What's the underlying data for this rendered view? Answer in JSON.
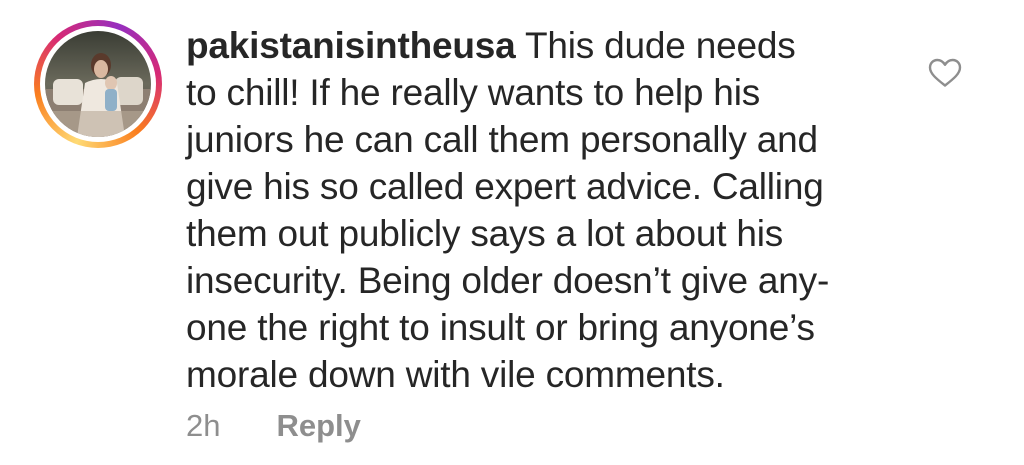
{
  "comment": {
    "username": "pakistanisintheusa",
    "lines": [
      "This dude needs",
      "to chill! If he really wants to help his",
      "juniors he can call them personally and",
      "give his so called expert advice. Calling",
      "them out publicly says a lot about his",
      "insecurity. Being older doesn’t give any-",
      "one the right to insult or bring anyone’s",
      "morale down with vile comments."
    ],
    "timestamp": "2h",
    "reply_label": "Reply",
    "icons": {
      "like": "heart-outline-icon",
      "avatar_ring": "story-ring"
    },
    "colors": {
      "text": "#262626",
      "meta": "#8e8e8e",
      "ring_start": "#feda75",
      "ring_mid": "#fa7e1e",
      "ring_end": "#d62976"
    }
  }
}
